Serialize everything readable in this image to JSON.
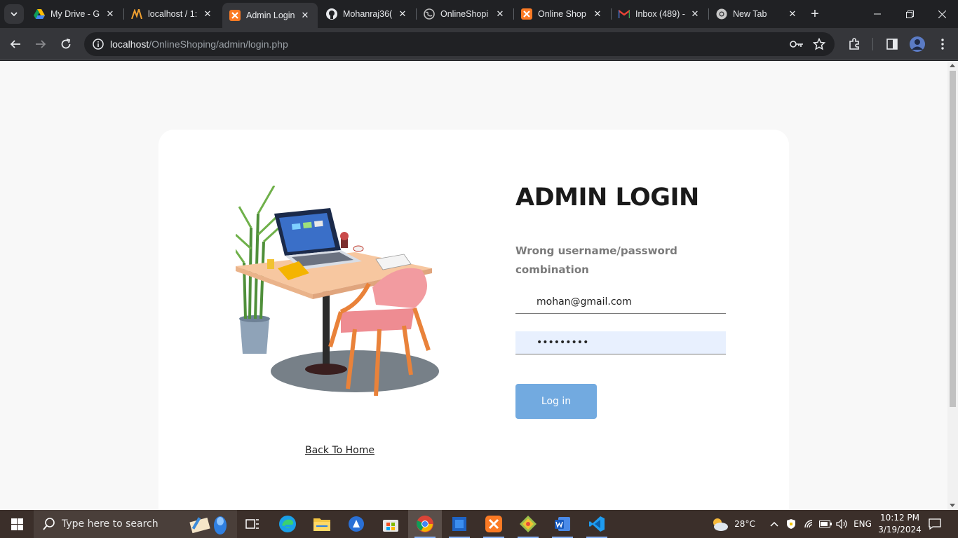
{
  "browser": {
    "tabs": [
      {
        "title": "My Drive - G",
        "favicon": "google-drive-icon",
        "active": false
      },
      {
        "title": "localhost / 1:",
        "favicon": "phpmyadmin-icon",
        "active": false
      },
      {
        "title": "Admin Login",
        "favicon": "xampp-icon",
        "active": true
      },
      {
        "title": "Mohanraj36(",
        "favicon": "github-icon",
        "active": false
      },
      {
        "title": "OnlineShopi",
        "favicon": "globe-icon",
        "active": false
      },
      {
        "title": "Online Shop",
        "favicon": "xampp-icon",
        "active": false
      },
      {
        "title": "Inbox (489) -",
        "favicon": "gmail-icon",
        "active": false
      },
      {
        "title": "New Tab",
        "favicon": "chrome-icon",
        "active": false
      }
    ],
    "url_host": "localhost",
    "url_path": "/OnlineShoping/admin/login.php"
  },
  "page": {
    "title": "ADMIN LOGIN",
    "error_message": "Wrong username/password combination",
    "email_value": "mohan@gmail.com",
    "password_value": "•••••••••",
    "login_button": "Log in",
    "back_link": "Back To Home",
    "illustration": "desk-laptop-illustration"
  },
  "taskbar": {
    "search_placeholder": "Type here to search",
    "weather": "28°C",
    "language": "ENG",
    "time": "10:12 PM",
    "date": "3/19/2024",
    "apps": [
      "task-view-icon",
      "edge-icon",
      "file-explorer-icon",
      "app-icon",
      "store-icon",
      "chrome-icon",
      "app-icon",
      "xampp-icon",
      "app-icon",
      "word-icon",
      "vscode-icon"
    ]
  },
  "colors": {
    "accent_button": "#72aae0",
    "autofill_bg": "#e8f0fe",
    "page_bg": "#f8f8f8",
    "chrome_dark": "#202124"
  }
}
